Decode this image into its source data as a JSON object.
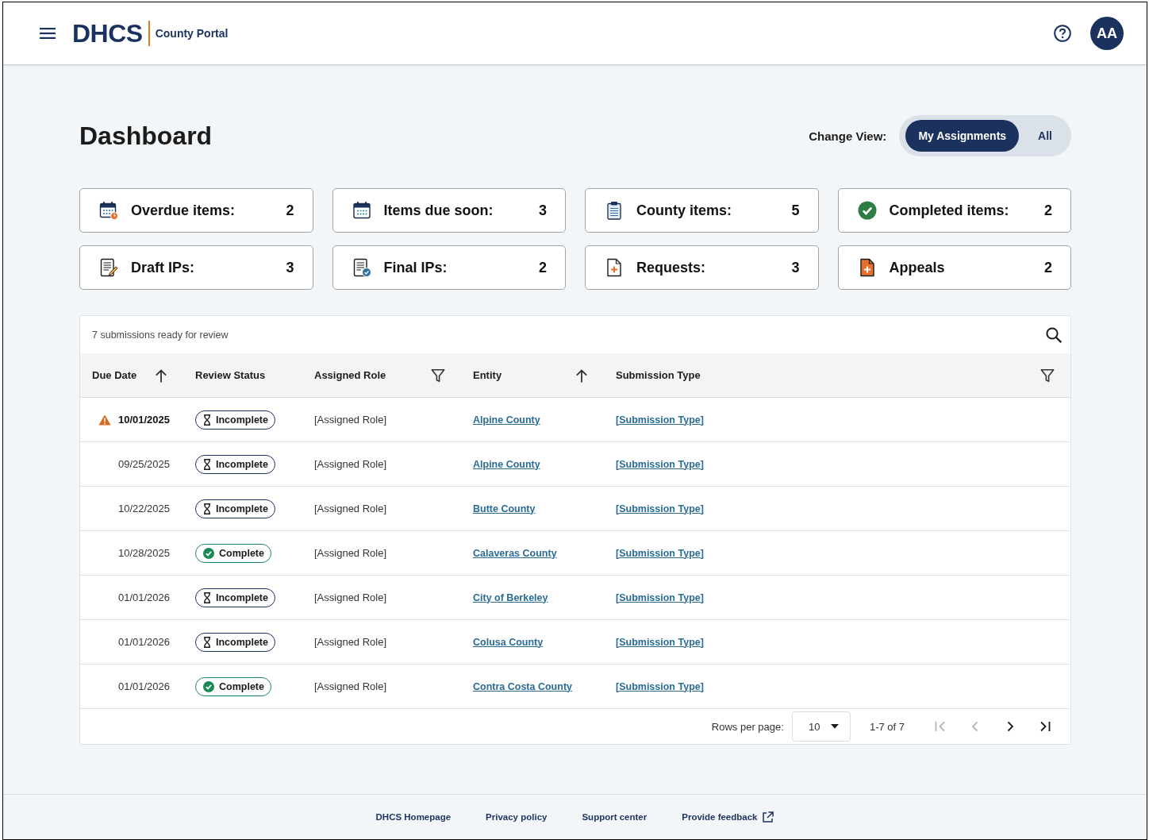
{
  "header": {
    "logo": "DHCS",
    "app_name": "County Portal",
    "avatar_initials": "AA"
  },
  "page": {
    "title": "Dashboard",
    "change_view_label": "Change View:",
    "view_options": [
      {
        "label": "My Assignments",
        "selected": true
      },
      {
        "label": "All",
        "selected": false
      }
    ]
  },
  "summary_cards": [
    {
      "kind": "overdue",
      "label": "Overdue items:",
      "count": "2"
    },
    {
      "kind": "due-soon",
      "label": "Items due soon:",
      "count": "3"
    },
    {
      "kind": "county",
      "label": "County items:",
      "count": "5"
    },
    {
      "kind": "completed",
      "label": "Completed items:",
      "count": "2"
    },
    {
      "kind": "draft",
      "label": "Draft IPs:",
      "count": "3"
    },
    {
      "kind": "final",
      "label": "Final IPs:",
      "count": "2"
    },
    {
      "kind": "request",
      "label": "Requests:",
      "count": "3"
    },
    {
      "kind": "appeal",
      "label": "Appeals",
      "count": "2"
    }
  ],
  "table": {
    "caption": "7 submissions ready for review",
    "columns": [
      {
        "label": "Due Date",
        "kind": "sortable"
      },
      {
        "label": "Review Status",
        "kind": "plain"
      },
      {
        "label": "Assigned Role",
        "kind": "filterable"
      },
      {
        "label": "Entity",
        "kind": "sortable"
      },
      {
        "label": "Submission Type",
        "kind": "filterable"
      }
    ],
    "rows": [
      {
        "due_date": "10/01/2025",
        "overdue": true,
        "status": {
          "kind": "incomplete",
          "label": "Incomplete"
        },
        "assigned_role": "[Assigned Role]",
        "entity": "Alpine County",
        "submission_type": "[Submission Type]"
      },
      {
        "due_date": "09/25/2025",
        "overdue": false,
        "status": {
          "kind": "incomplete",
          "label": "Incomplete"
        },
        "assigned_role": "[Assigned Role]",
        "entity": "Alpine County",
        "submission_type": "[Submission Type]"
      },
      {
        "due_date": "10/22/2025",
        "overdue": false,
        "status": {
          "kind": "incomplete",
          "label": "Incomplete"
        },
        "assigned_role": "[Assigned Role]",
        "entity": "Butte County",
        "submission_type": "[Submission Type]"
      },
      {
        "due_date": "10/28/2025",
        "overdue": false,
        "status": {
          "kind": "complete",
          "label": "Complete"
        },
        "assigned_role": "[Assigned Role]",
        "entity": "Calaveras County",
        "submission_type": "[Submission Type]"
      },
      {
        "due_date": "01/01/2026",
        "overdue": false,
        "status": {
          "kind": "incomplete",
          "label": "Incomplete"
        },
        "assigned_role": "[Assigned Role]",
        "entity": "City of Berkeley",
        "submission_type": "[Submission Type]"
      },
      {
        "due_date": "01/01/2026",
        "overdue": false,
        "status": {
          "kind": "incomplete",
          "label": "Incomplete"
        },
        "assigned_role": "[Assigned Role]",
        "entity": "Colusa County",
        "submission_type": "[Submission Type]"
      },
      {
        "due_date": "01/01/2026",
        "overdue": false,
        "status": {
          "kind": "complete",
          "label": "Complete"
        },
        "assigned_role": "[Assigned Role]",
        "entity": "Contra Costa County",
        "submission_type": "[Submission Type]"
      }
    ],
    "pagination": {
      "rows_per_page_label": "Rows per page:",
      "rows_per_page": "10",
      "range": "1-7 of 7",
      "buttons": [
        {
          "kind": "first",
          "disabled": true
        },
        {
          "kind": "previous",
          "disabled": true
        },
        {
          "kind": "next",
          "disabled": false
        },
        {
          "kind": "last",
          "disabled": false
        }
      ]
    }
  },
  "footer": {
    "links": [
      {
        "label": "DHCS Homepage",
        "external": false
      },
      {
        "label": "Privacy policy",
        "external": false
      },
      {
        "label": "Support center",
        "external": false
      },
      {
        "label": "Provide feedback",
        "external": true
      }
    ]
  }
}
